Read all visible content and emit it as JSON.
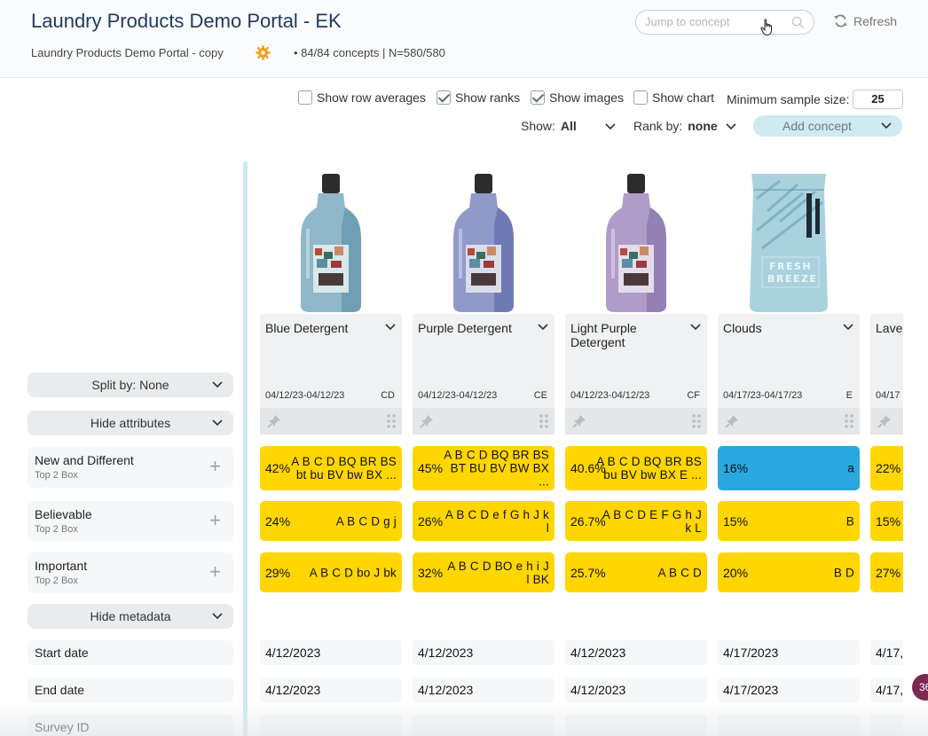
{
  "header": {
    "title": "Laundry Products Demo Portal - EK",
    "subtitle": "Laundry Products Demo Portal - copy",
    "stats": "• 84/84 concepts | N=580/580",
    "search_placeholder": "Jump to concept",
    "refresh_label": "Refresh"
  },
  "toolbar": {
    "row_averages": {
      "label": "Show row averages",
      "checked": false
    },
    "ranks": {
      "label": "Show ranks",
      "checked": true
    },
    "images": {
      "label": "Show images",
      "checked": true
    },
    "chart": {
      "label": "Show chart",
      "checked": false
    },
    "min_sample_label": "Minimum sample size:",
    "min_sample_value": "25",
    "show_label": "Show:",
    "show_value": "All",
    "rank_label": "Rank by:",
    "rank_value": "none",
    "add_concept": "Add concept"
  },
  "left": {
    "split_by": "Split by: None",
    "hide_attributes": "Hide attributes",
    "hide_metadata": "Hide metadata",
    "attributes": [
      {
        "name": "New and Different",
        "sub": "Top 2 Box"
      },
      {
        "name": "Believable",
        "sub": "Top 2 Box"
      },
      {
        "name": "Important",
        "sub": "Top 2 Box"
      }
    ],
    "metadata": [
      "Start date",
      "End date",
      "Survey ID"
    ]
  },
  "concepts": [
    {
      "name": "Blue Detergent",
      "dates": "04/12/23-04/12/23",
      "code": "CD",
      "image": "blue-detergent-bottle",
      "values": [
        {
          "pct": "42%",
          "letters": "A B C D BQ BR BS bt bu BV bw BX ..."
        },
        {
          "pct": "24%",
          "letters": "A B C D g j"
        },
        {
          "pct": "29%",
          "letters": "A B C D bo J bk"
        }
      ],
      "start": "4/12/2023",
      "end": "4/12/2023"
    },
    {
      "name": "Purple Detergent",
      "dates": "04/12/23-04/12/23",
      "code": "CE",
      "image": "purple-detergent-bottle",
      "values": [
        {
          "pct": "45%",
          "letters": "A B C D BQ BR BS BT BU BV BW BX ..."
        },
        {
          "pct": "26%",
          "letters": "A B C D e f G h J k l"
        },
        {
          "pct": "32%",
          "letters": "A B C D BO e h i J l BK"
        }
      ],
      "start": "4/12/2023",
      "end": "4/12/2023"
    },
    {
      "name": "Light Purple Detergent",
      "dates": "04/12/23-04/12/23",
      "code": "CF",
      "image": "light-purple-detergent-bottle",
      "values": [
        {
          "pct": "40.6%",
          "letters": "A B C D BQ BR BS bu BV bw BX E ..."
        },
        {
          "pct": "26.7%",
          "letters": "A B C D E F G h J k L"
        },
        {
          "pct": "25.7%",
          "letters": "A B C D"
        }
      ],
      "start": "4/12/2023",
      "end": "4/12/2023"
    },
    {
      "name": "Clouds",
      "dates": "04/17/23-04/17/23",
      "code": "E",
      "image": "fresh-breeze-bag",
      "values": [
        {
          "pct": "16%",
          "letters": "a",
          "color": "blue"
        },
        {
          "pct": "15%",
          "letters": "B"
        },
        {
          "pct": "20%",
          "letters": "B D"
        }
      ],
      "start": "4/17/2023",
      "end": "4/17/2023"
    },
    {
      "name": "Lave",
      "dates": "04/17",
      "code": "",
      "image": "",
      "values": [
        {
          "pct": "22%",
          "letters": ""
        },
        {
          "pct": "15%",
          "letters": ""
        },
        {
          "pct": "27%",
          "letters": ""
        }
      ],
      "start": "4/17,",
      "end": "4/17,"
    }
  ],
  "chat_badge": "36",
  "colors": {
    "highlight_yellow": "#ffd600",
    "highlight_blue": "#29a8e0",
    "accent_teal": "#cfeaf0",
    "title": "#1e3a5f"
  }
}
